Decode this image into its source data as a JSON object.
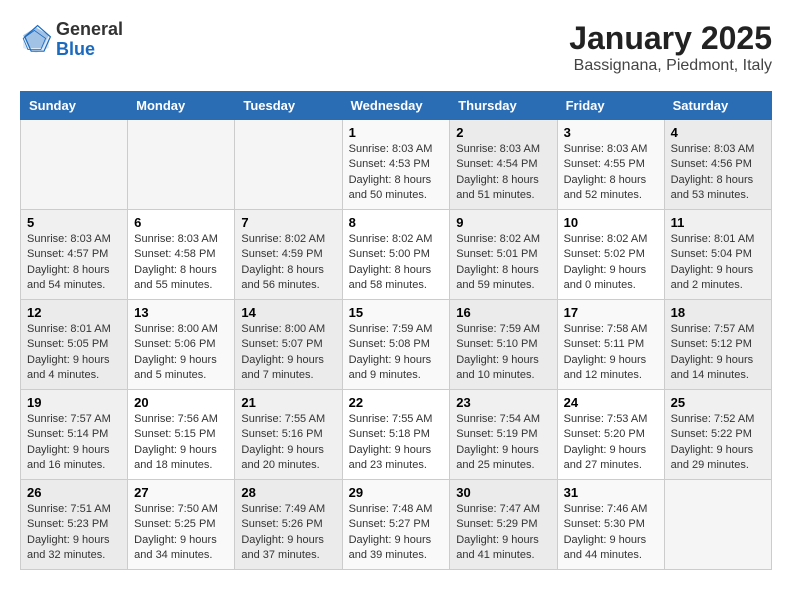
{
  "header": {
    "logo_general": "General",
    "logo_blue": "Blue",
    "month_year": "January 2025",
    "location": "Bassignana, Piedmont, Italy"
  },
  "days_of_week": [
    "Sunday",
    "Monday",
    "Tuesday",
    "Wednesday",
    "Thursday",
    "Friday",
    "Saturday"
  ],
  "weeks": [
    [
      {
        "day": "",
        "info": ""
      },
      {
        "day": "",
        "info": ""
      },
      {
        "day": "",
        "info": ""
      },
      {
        "day": "1",
        "info": "Sunrise: 8:03 AM\nSunset: 4:53 PM\nDaylight: 8 hours\nand 50 minutes."
      },
      {
        "day": "2",
        "info": "Sunrise: 8:03 AM\nSunset: 4:54 PM\nDaylight: 8 hours\nand 51 minutes."
      },
      {
        "day": "3",
        "info": "Sunrise: 8:03 AM\nSunset: 4:55 PM\nDaylight: 8 hours\nand 52 minutes."
      },
      {
        "day": "4",
        "info": "Sunrise: 8:03 AM\nSunset: 4:56 PM\nDaylight: 8 hours\nand 53 minutes."
      }
    ],
    [
      {
        "day": "5",
        "info": "Sunrise: 8:03 AM\nSunset: 4:57 PM\nDaylight: 8 hours\nand 54 minutes."
      },
      {
        "day": "6",
        "info": "Sunrise: 8:03 AM\nSunset: 4:58 PM\nDaylight: 8 hours\nand 55 minutes."
      },
      {
        "day": "7",
        "info": "Sunrise: 8:02 AM\nSunset: 4:59 PM\nDaylight: 8 hours\nand 56 minutes."
      },
      {
        "day": "8",
        "info": "Sunrise: 8:02 AM\nSunset: 5:00 PM\nDaylight: 8 hours\nand 58 minutes."
      },
      {
        "day": "9",
        "info": "Sunrise: 8:02 AM\nSunset: 5:01 PM\nDaylight: 8 hours\nand 59 minutes."
      },
      {
        "day": "10",
        "info": "Sunrise: 8:02 AM\nSunset: 5:02 PM\nDaylight: 9 hours\nand 0 minutes."
      },
      {
        "day": "11",
        "info": "Sunrise: 8:01 AM\nSunset: 5:04 PM\nDaylight: 9 hours\nand 2 minutes."
      }
    ],
    [
      {
        "day": "12",
        "info": "Sunrise: 8:01 AM\nSunset: 5:05 PM\nDaylight: 9 hours\nand 4 minutes."
      },
      {
        "day": "13",
        "info": "Sunrise: 8:00 AM\nSunset: 5:06 PM\nDaylight: 9 hours\nand 5 minutes."
      },
      {
        "day": "14",
        "info": "Sunrise: 8:00 AM\nSunset: 5:07 PM\nDaylight: 9 hours\nand 7 minutes."
      },
      {
        "day": "15",
        "info": "Sunrise: 7:59 AM\nSunset: 5:08 PM\nDaylight: 9 hours\nand 9 minutes."
      },
      {
        "day": "16",
        "info": "Sunrise: 7:59 AM\nSunset: 5:10 PM\nDaylight: 9 hours\nand 10 minutes."
      },
      {
        "day": "17",
        "info": "Sunrise: 7:58 AM\nSunset: 5:11 PM\nDaylight: 9 hours\nand 12 minutes."
      },
      {
        "day": "18",
        "info": "Sunrise: 7:57 AM\nSunset: 5:12 PM\nDaylight: 9 hours\nand 14 minutes."
      }
    ],
    [
      {
        "day": "19",
        "info": "Sunrise: 7:57 AM\nSunset: 5:14 PM\nDaylight: 9 hours\nand 16 minutes."
      },
      {
        "day": "20",
        "info": "Sunrise: 7:56 AM\nSunset: 5:15 PM\nDaylight: 9 hours\nand 18 minutes."
      },
      {
        "day": "21",
        "info": "Sunrise: 7:55 AM\nSunset: 5:16 PM\nDaylight: 9 hours\nand 20 minutes."
      },
      {
        "day": "22",
        "info": "Sunrise: 7:55 AM\nSunset: 5:18 PM\nDaylight: 9 hours\nand 23 minutes."
      },
      {
        "day": "23",
        "info": "Sunrise: 7:54 AM\nSunset: 5:19 PM\nDaylight: 9 hours\nand 25 minutes."
      },
      {
        "day": "24",
        "info": "Sunrise: 7:53 AM\nSunset: 5:20 PM\nDaylight: 9 hours\nand 27 minutes."
      },
      {
        "day": "25",
        "info": "Sunrise: 7:52 AM\nSunset: 5:22 PM\nDaylight: 9 hours\nand 29 minutes."
      }
    ],
    [
      {
        "day": "26",
        "info": "Sunrise: 7:51 AM\nSunset: 5:23 PM\nDaylight: 9 hours\nand 32 minutes."
      },
      {
        "day": "27",
        "info": "Sunrise: 7:50 AM\nSunset: 5:25 PM\nDaylight: 9 hours\nand 34 minutes."
      },
      {
        "day": "28",
        "info": "Sunrise: 7:49 AM\nSunset: 5:26 PM\nDaylight: 9 hours\nand 37 minutes."
      },
      {
        "day": "29",
        "info": "Sunrise: 7:48 AM\nSunset: 5:27 PM\nDaylight: 9 hours\nand 39 minutes."
      },
      {
        "day": "30",
        "info": "Sunrise: 7:47 AM\nSunset: 5:29 PM\nDaylight: 9 hours\nand 41 minutes."
      },
      {
        "day": "31",
        "info": "Sunrise: 7:46 AM\nSunset: 5:30 PM\nDaylight: 9 hours\nand 44 minutes."
      },
      {
        "day": "",
        "info": ""
      }
    ]
  ]
}
